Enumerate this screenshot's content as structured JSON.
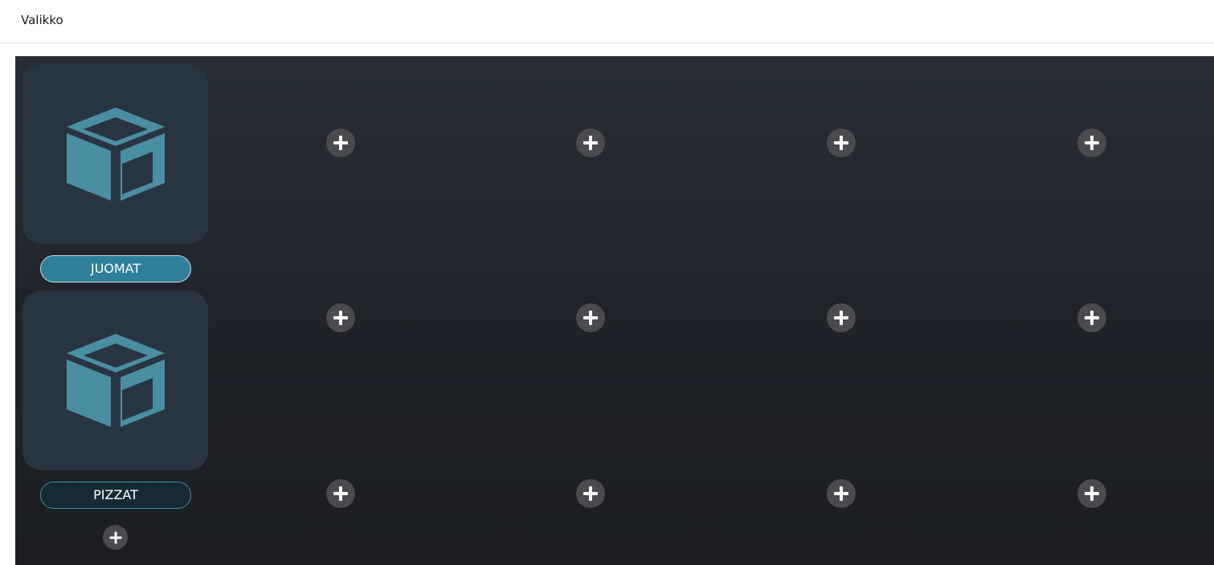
{
  "header": {
    "title": "Valikko"
  },
  "categories": [
    {
      "label": "JUOMAT",
      "icon": "box-icon",
      "active": true
    },
    {
      "label": "PIZZAT",
      "icon": "box-icon",
      "active": false
    }
  ],
  "colors": {
    "accent": "#2f7f9b",
    "icon": "#4a8ea3",
    "tile": "#283540",
    "add_button": "#4b4b4f"
  },
  "add_buttons": {
    "icon": "plus-icon",
    "grid_rows": 3,
    "grid_columns": 4
  }
}
